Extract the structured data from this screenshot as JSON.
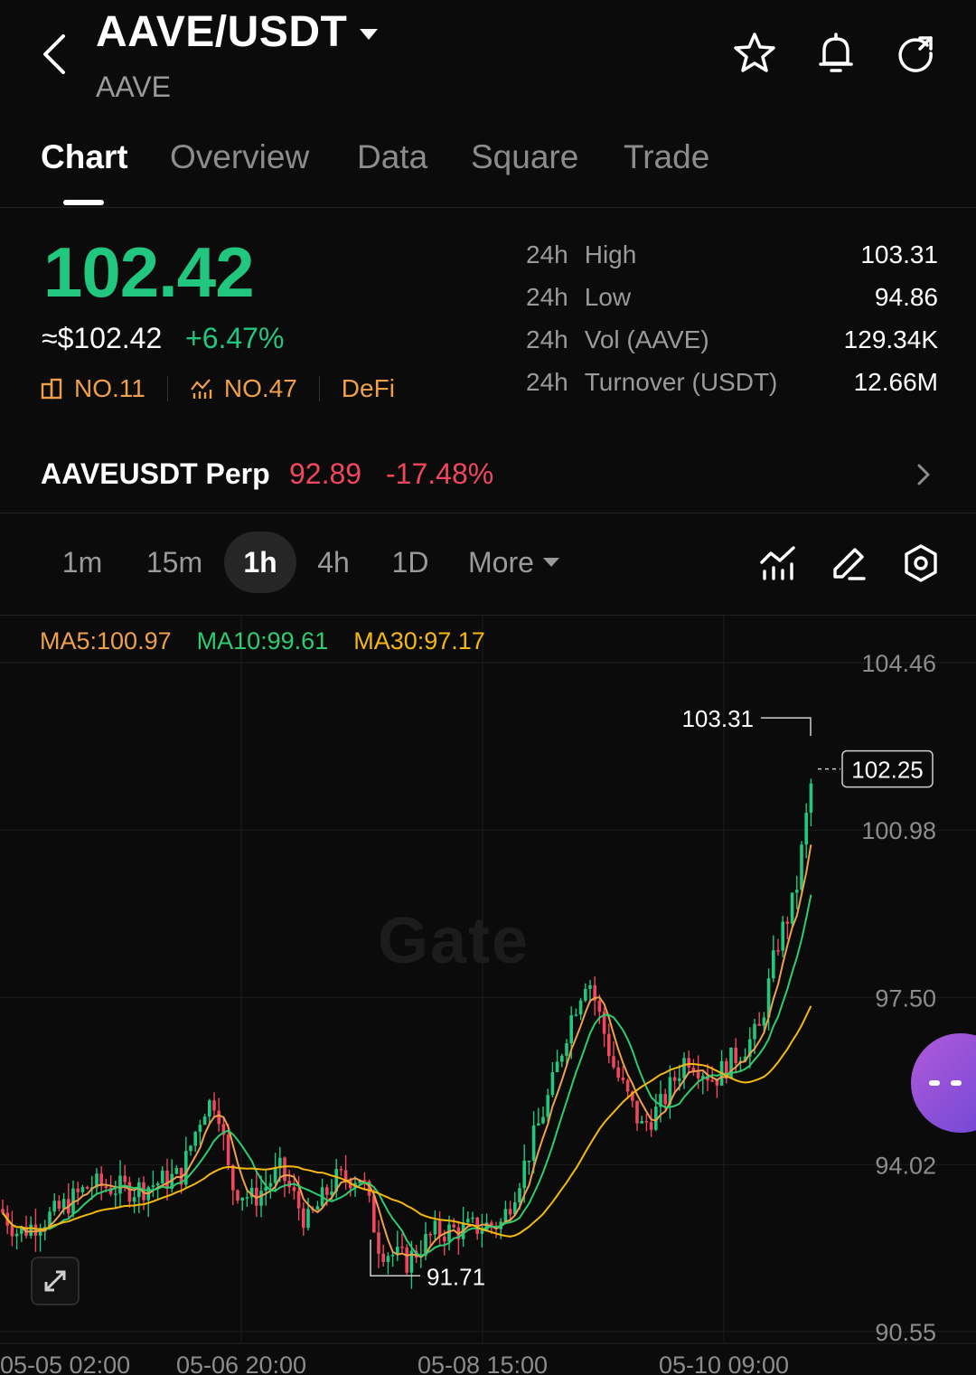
{
  "header": {
    "pair": "AAVE/USDT",
    "base": "AAVE"
  },
  "icons": {
    "back": "back-arrow-icon",
    "favorite": "star-icon",
    "alert": "bell-icon",
    "refresh": "refresh-icon"
  },
  "tabs": [
    "Chart",
    "Overview",
    "Data",
    "Square",
    "Trade"
  ],
  "price": {
    "last": "102.42",
    "usd": "≈$102.42",
    "change": "+6.47%",
    "rank_market": "NO.11",
    "rank_trend": "NO.47",
    "category": "DeFi"
  },
  "stats": [
    {
      "period": "24h",
      "label": "High",
      "value": "103.31"
    },
    {
      "period": "24h",
      "label": "Low",
      "value": "94.86"
    },
    {
      "period": "24h",
      "label": "Vol (AAVE)",
      "value": "129.34K"
    },
    {
      "period": "24h",
      "label": "Turnover (USDT)",
      "value": "12.66M"
    }
  ],
  "perp": {
    "name": "AAVEUSDT Perp",
    "price": "92.89",
    "change": "-17.48%"
  },
  "intervals": {
    "items": [
      "1m",
      "15m",
      "1h",
      "4h",
      "1D"
    ],
    "active": "1h",
    "more_label": "More"
  },
  "ma": {
    "ma5": "MA5:100.97",
    "ma10": "MA10:99.61",
    "ma30": "MA30:97.17"
  },
  "colors": {
    "up": "#21c77f",
    "down": "#f0475d",
    "ma5": "#f0a04b",
    "ma10": "#2ecc71",
    "ma30": "#f5b80f",
    "rank": "#f0a04b"
  },
  "chart_data": {
    "type": "candlestick",
    "y_axis_labels": [
      "104.46",
      "100.98",
      "97.50",
      "94.02",
      "90.55"
    ],
    "ylim": [
      90.55,
      104.46
    ],
    "x_axis_labels": [
      "05-05 02:00",
      "05-06 20:00",
      "05-08 15:00",
      "05-10 09:00"
    ],
    "high_marker": "103.31",
    "low_marker": "91.71",
    "current_price_tag": "102.25",
    "watermark": "Gate"
  }
}
